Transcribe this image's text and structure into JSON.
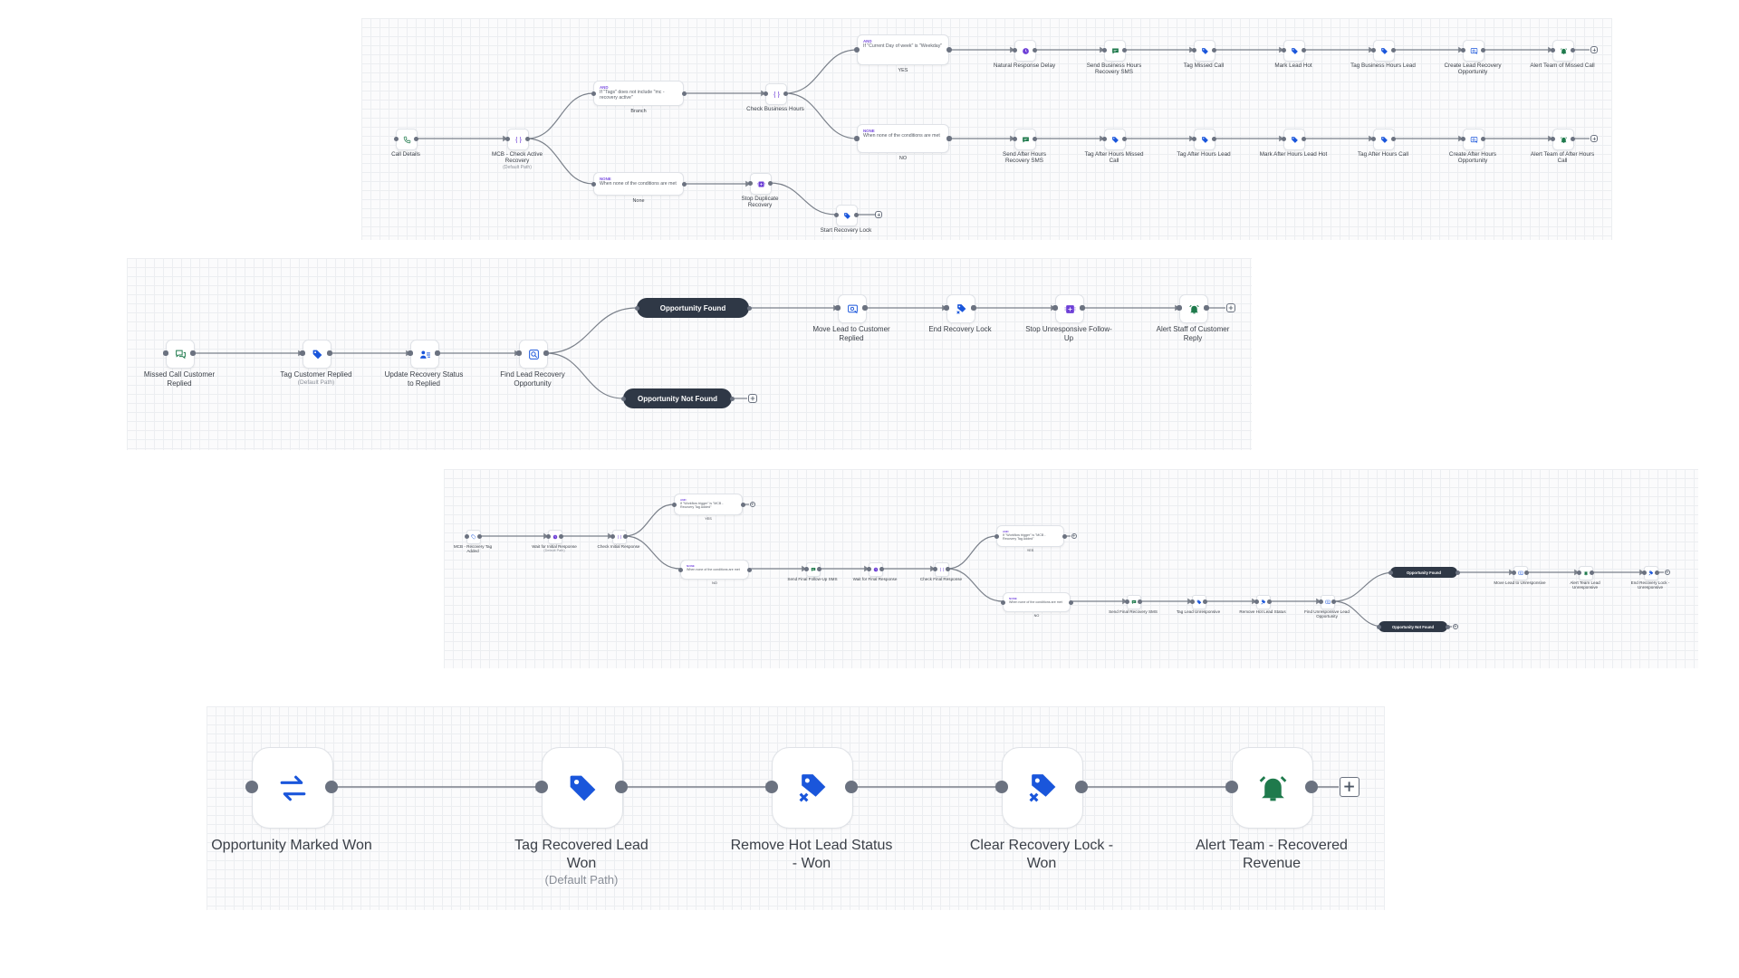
{
  "colors": {
    "green": "#1f7a4c",
    "blue": "#1a56db",
    "purple": "#6d3fd6",
    "dark_pill": "#2f3846",
    "wire": "#7a808a"
  },
  "flow1": {
    "trigger": "Call Details",
    "check_active": "MCB - Check Active Recovery",
    "check_active_sub": "(Default Path)",
    "branch_cond_tag": "AND",
    "branch_cond_text": "If \"Tags\" does not include \"mc - recovery active\"",
    "branch_label": "Branch",
    "none_cond_tag": "NONE",
    "none_cond_text": "When none of the conditions are met",
    "none_label": "None",
    "check_hours": "Check Business Hours",
    "yes_cond_tag": "AND",
    "yes_cond_text": "If \"Current Day of week\" is \"Weekday\"",
    "yes_label": "YES",
    "no_cond_tag": "NONE",
    "no_cond_text": "When none of the conditions are met",
    "no_label": "NO",
    "stop_duplicate": "Stop Duplicate Recovery",
    "start_lock": "Start Recovery Lock",
    "yes_steps": [
      "Natural Response Delay",
      "Send Business Hours Recovery SMS",
      "Tag Missed Call",
      "Mark Lead Hot",
      "Tag Business Hours Lead",
      "Create Lead Recovery Opportunity",
      "Alert Team of Missed Call"
    ],
    "no_steps": [
      "Send After Hours Recovery SMS",
      "Tag After Hours Missed Call",
      "Tag After Hours Lead",
      "Mark After Hours Lead Hot",
      "Tag After Hours Call",
      "Create After Hours Opportunity",
      "Alert Team of After Hours Call"
    ]
  },
  "flow2": {
    "trigger": "Missed Call Customer Replied",
    "tag_replied": "Tag Customer Replied",
    "tag_replied_sub": "(Default Path)",
    "update_status": "Update Recovery Status to Replied",
    "find_opp": "Find Lead Recovery Opportunity",
    "found": "Opportunity Found",
    "not_found": "Opportunity Not Found",
    "found_steps": [
      "Move Lead to Customer Replied",
      "End Recovery Lock",
      "Stop Unresponsive Follow-Up",
      "Alert Staff of Customer Reply"
    ]
  },
  "flow3": {
    "trigger": "MCB - Recovery Tag Added",
    "wait_initial": "Wait for Initial Response",
    "wait_initial_sub": "(Default Path)",
    "check_initial": "Check Initial Response",
    "yes1_tag": "AND",
    "yes1_text": "If \"Workflow trigger\" is \"MCB - Recovery Tag Added\"",
    "yes1_label": "YES",
    "no1_tag": "NONE",
    "no1_text": "When none of the conditions are met",
    "no1_label": "NO",
    "send_final": "Send Final Follow-Up SMS",
    "wait_final": "Wait for Final Response",
    "check_final": "Check Final Response",
    "yes2_tag": "AND",
    "yes2_text": "If \"Workflow trigger\" is \"MCB - Recovery Tag Added\"",
    "yes2_label": "YES",
    "no2_tag": "NONE",
    "no2_text": "When none of the conditions are met",
    "no2_label": "NO",
    "no2_steps": [
      "Send Final Recovery SMS",
      "Tag Lead Unresponsive",
      "Remove Hot Lead Status",
      "Find Unresponsive Lead Opportunity"
    ],
    "found": "Opportunity Found",
    "not_found": "Opportunity Not Found",
    "found_steps": [
      "Move Lead to Unresponsive",
      "Alert Team Lead Unresponsive",
      "End Recovery Lock - Unresponsive"
    ]
  },
  "flow4": {
    "steps": [
      "Opportunity Marked Won",
      "Tag Recovered Lead Won",
      "Remove Hot Lead Status - Won",
      "Clear Recovery Lock - Won",
      "Alert Team - Recovered Revenue"
    ],
    "tag_sub": "(Default Path)"
  }
}
